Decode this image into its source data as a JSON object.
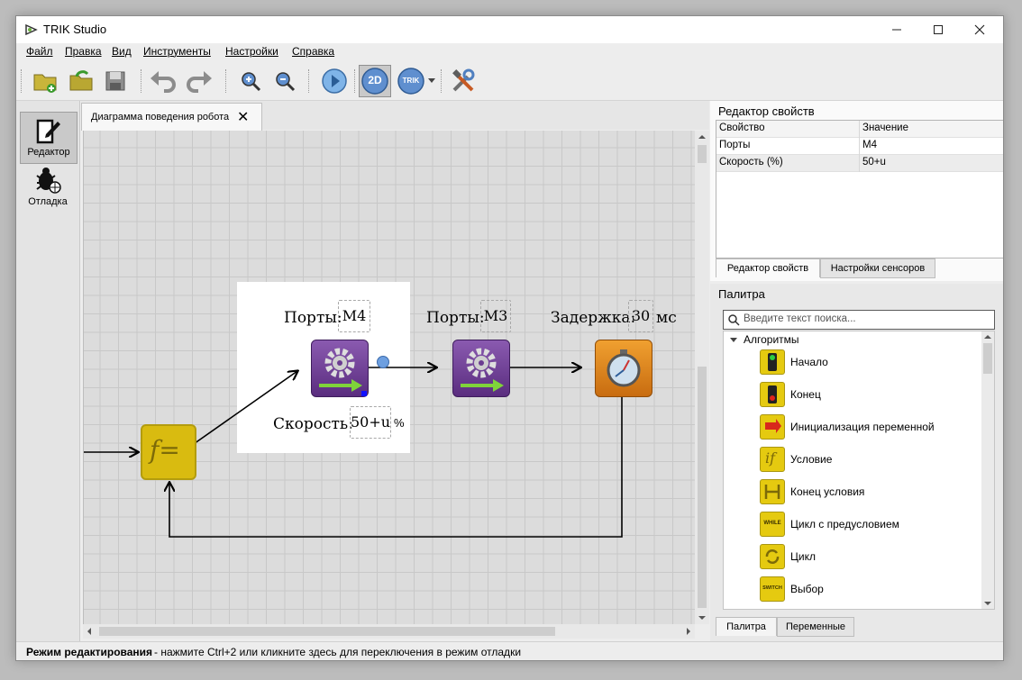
{
  "window": {
    "title": "TRIK Studio"
  },
  "menu": [
    "Файл",
    "Правка",
    "Вид",
    "Инструменты",
    "Настройки",
    "Справка"
  ],
  "left_dock": {
    "editor_label": "Редактор",
    "debug_label": "Отладка"
  },
  "tab": {
    "label": "Диаграмма поведения робота",
    "close": "✕"
  },
  "toolbar": {
    "mode_2d": "2D",
    "trik": "TRIK"
  },
  "diagram": {
    "formula_symbol": "f=",
    "motor1": {
      "ports_label": "Порты:",
      "ports_value": "M4",
      "speed_label": "Скорость:",
      "speed_value": "50+u",
      "speed_unit": "%"
    },
    "motor2": {
      "ports_label": "Порты:",
      "ports_value": "M3"
    },
    "timer": {
      "delay_label": "Задержка:",
      "delay_value": "30",
      "delay_unit": "мс"
    }
  },
  "properties": {
    "title": "Редактор свойств",
    "columns": [
      "Свойство",
      "Значение"
    ],
    "rows": [
      {
        "name": "Порты",
        "value": "M4"
      },
      {
        "name": "Скорость (%)",
        "value": "50+u"
      }
    ],
    "tabs": [
      "Редактор свойств",
      "Настройки сенсоров"
    ]
  },
  "palette": {
    "title": "Палитра",
    "search_placeholder": "Введите текст поиска...",
    "category": "Алгоритмы",
    "items": [
      "Начало",
      "Конец",
      "Инициализация переменной",
      "Условие",
      "Конец условия",
      "Цикл с предусловием",
      "Цикл",
      "Выбор"
    ],
    "icon_texts": {
      "while": "WHILE",
      "switch": "SWITCH"
    },
    "tabs": [
      "Палитра",
      "Переменные"
    ]
  },
  "status": {
    "mode": "Режим редактирования",
    "hint": " - нажмите Ctrl+2 или кликните здесь для переключения в режим отладки"
  }
}
